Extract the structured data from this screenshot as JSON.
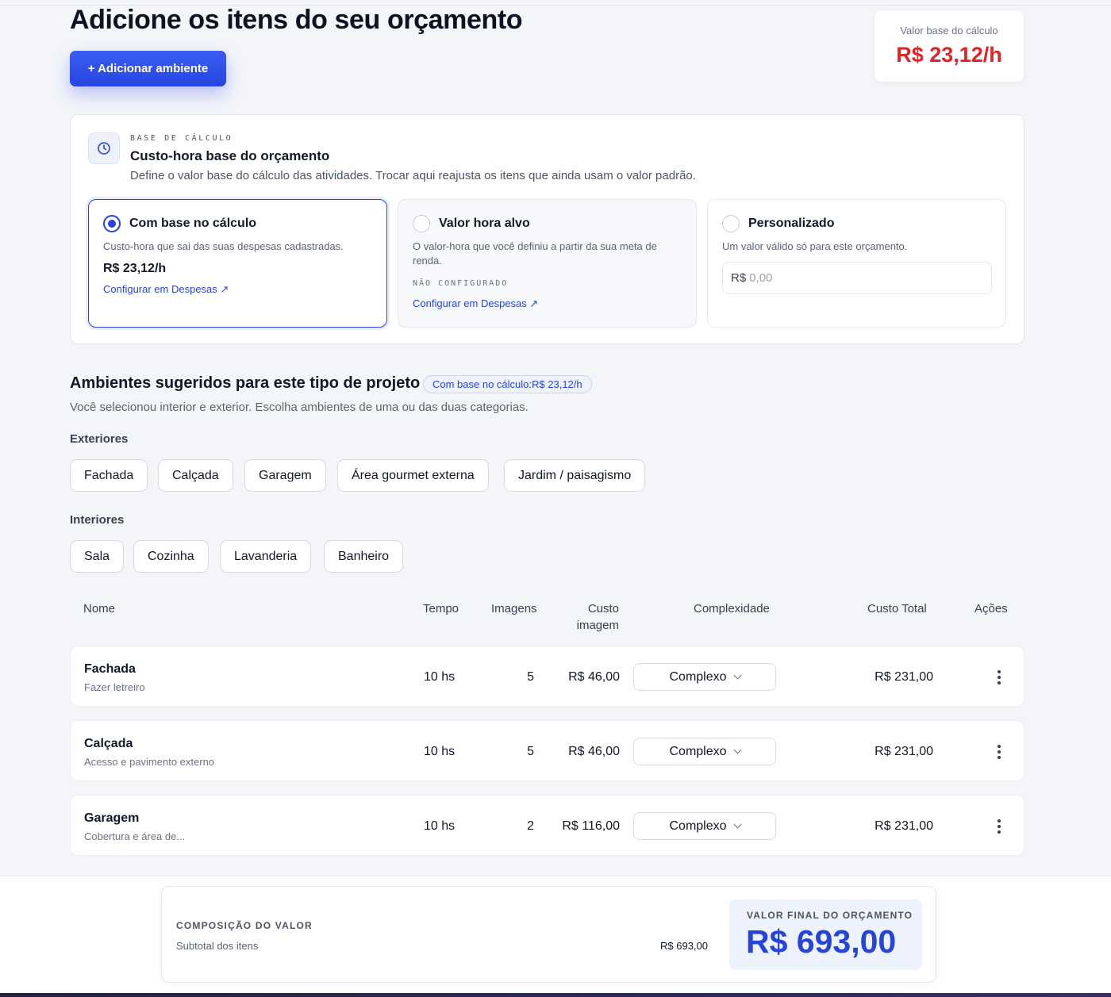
{
  "header": {
    "title": "Adicione os itens do seu orçamento",
    "add_button": "+ Adicionar ambiente"
  },
  "base_value": {
    "label": "Valor base do cálculo",
    "value": "R$ 23,12/h",
    "color": "#dc2626"
  },
  "calc": {
    "icon": "clock-icon",
    "eyebrow": "BASE DE CÁLCULO",
    "title": "Custo-hora base do orçamento",
    "description": "Define o valor base do cálculo das atividades. Trocar aqui reajusta os itens que ainda usam o valor padrão.",
    "options": [
      {
        "title": "Com base no cálculo",
        "description": "Custo-hora que sai das suas despesas cadastradas.",
        "value": "R$ 23,12/h",
        "link": "Configurar em Despesas ↗",
        "selected": true
      },
      {
        "title": "Valor hora alvo",
        "description": "O valor-hora que você definiu a partir da sua meta de renda.",
        "tag": "NÃO CONFIGURADO",
        "link": "Configurar em Despesas ↗",
        "selected": false
      },
      {
        "title": "Personalizado",
        "description": "Um valor válido só para este orçamento.",
        "input_prefix": "R$",
        "input_placeholder": "0,00",
        "selected": false
      }
    ]
  },
  "suggested": {
    "title": "Ambientes sugeridos para este tipo de projeto",
    "badge": "Com base no cálculo:R$ 23,12/h",
    "description": "Você selecionou interior e exterior. Escolha ambientes de uma ou das duas categorias.",
    "exteriors_label": "Exteriores",
    "exteriors": [
      "Fachada",
      "Calçada",
      "Garagem",
      "Área gourmet externa",
      "Jardim / paisagismo"
    ],
    "interiors_label": "Interiores",
    "interiors": [
      "Sala",
      "Cozinha",
      "Lavanderia",
      "Banheiro"
    ]
  },
  "table": {
    "headers": {
      "name": "Nome",
      "time": "Tempo",
      "images": "Imagens",
      "image_cost_1": "Custo",
      "image_cost_2": "imagem",
      "complexity": "Complexidade",
      "total": "Custo Total",
      "actions": "Ações"
    },
    "rows": [
      {
        "name": "Fachada",
        "subtitle": "Fazer letreiro",
        "time": "10 hs",
        "images": "5",
        "image_cost": "R$ 46,00",
        "complexity": "Complexo",
        "total": "R$ 231,00"
      },
      {
        "name": "Calçada",
        "subtitle": "Acesso e pavimento externo",
        "time": "10 hs",
        "images": "5",
        "image_cost": "R$ 46,00",
        "complexity": "Complexo",
        "total": "R$ 231,00"
      },
      {
        "name": "Garagem",
        "subtitle": "Cobertura e área de...",
        "time": "10 hs",
        "images": "2",
        "image_cost": "R$ 116,00",
        "complexity": "Complexo",
        "total": "R$ 231,00"
      }
    ]
  },
  "footer": {
    "composition_title": "COMPOSIÇÃO DO VALOR",
    "subtotal_label": "Subtotal dos itens",
    "subtotal_value": "R$ 693,00",
    "final_label": "VALOR FINAL DO ORÇAMENTO",
    "final_value": "R$ 693,00"
  },
  "colors": {
    "accent": "#2744d8",
    "danger": "#dc2626",
    "background": "#f4f5f9"
  }
}
